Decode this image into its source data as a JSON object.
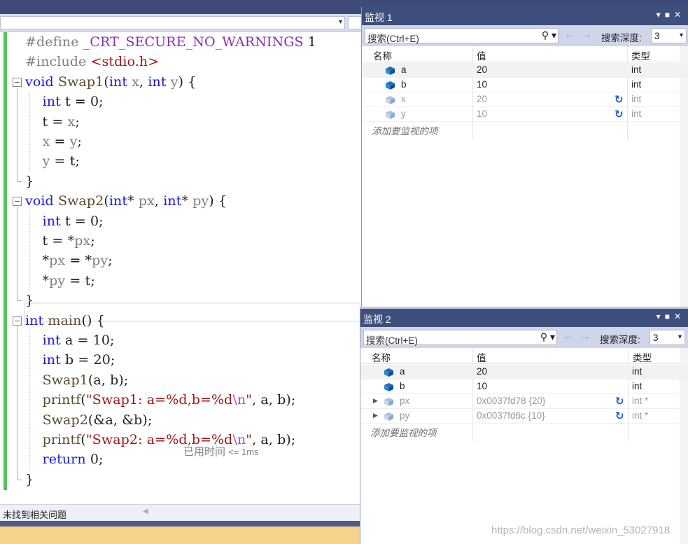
{
  "editor": {
    "lines": [
      {
        "parts": [
          {
            "c": "pp",
            "t": "#define "
          },
          {
            "c": "macro",
            "t": "_CRT_SECURE_NO_WARNINGS"
          },
          {
            "c": "",
            "t": " 1"
          }
        ]
      },
      {
        "parts": [
          {
            "c": "pp",
            "t": "#include "
          },
          {
            "c": "str",
            "t": "<stdio.h>"
          }
        ]
      },
      {
        "parts": [
          {
            "c": "kw",
            "t": "void"
          },
          {
            "c": "",
            "t": " "
          },
          {
            "c": "fn",
            "t": "Swap1"
          },
          {
            "c": "",
            "t": "("
          },
          {
            "c": "kw",
            "t": "int"
          },
          {
            "c": "pa",
            "t": " x"
          },
          {
            "c": "",
            "t": ", "
          },
          {
            "c": "kw",
            "t": "int"
          },
          {
            "c": "pa",
            "t": " y"
          },
          {
            "c": "",
            "t": ") {"
          }
        ]
      },
      {
        "parts": [
          {
            "c": "",
            "t": "    "
          },
          {
            "c": "kw",
            "t": "int"
          },
          {
            "c": "",
            "t": " t = 0;"
          }
        ]
      },
      {
        "parts": [
          {
            "c": "",
            "t": "    t = "
          },
          {
            "c": "pa",
            "t": "x"
          },
          {
            "c": "",
            "t": ";"
          }
        ]
      },
      {
        "parts": [
          {
            "c": "",
            "t": "    "
          },
          {
            "c": "pa",
            "t": "x"
          },
          {
            "c": "",
            "t": " = "
          },
          {
            "c": "pa",
            "t": "y"
          },
          {
            "c": "",
            "t": ";"
          }
        ]
      },
      {
        "parts": [
          {
            "c": "",
            "t": "    "
          },
          {
            "c": "pa",
            "t": "y"
          },
          {
            "c": "",
            "t": " = t;"
          }
        ]
      },
      {
        "parts": [
          {
            "c": "",
            "t": "}"
          }
        ]
      },
      {
        "parts": [
          {
            "c": "kw",
            "t": "void"
          },
          {
            "c": "",
            "t": " "
          },
          {
            "c": "fn",
            "t": "Swap2"
          },
          {
            "c": "",
            "t": "("
          },
          {
            "c": "kw",
            "t": "int"
          },
          {
            "c": "",
            "t": "* "
          },
          {
            "c": "pa",
            "t": "px"
          },
          {
            "c": "",
            "t": ", "
          },
          {
            "c": "kw",
            "t": "int"
          },
          {
            "c": "",
            "t": "* "
          },
          {
            "c": "pa",
            "t": "py"
          },
          {
            "c": "",
            "t": ") {"
          }
        ]
      },
      {
        "parts": [
          {
            "c": "",
            "t": "    "
          },
          {
            "c": "kw",
            "t": "int"
          },
          {
            "c": "",
            "t": " t = 0;"
          }
        ]
      },
      {
        "parts": [
          {
            "c": "",
            "t": "    t = *"
          },
          {
            "c": "pa",
            "t": "px"
          },
          {
            "c": "",
            "t": ";"
          }
        ]
      },
      {
        "parts": [
          {
            "c": "",
            "t": "    *"
          },
          {
            "c": "pa",
            "t": "px"
          },
          {
            "c": "",
            "t": " = *"
          },
          {
            "c": "pa",
            "t": "py"
          },
          {
            "c": "",
            "t": ";"
          }
        ]
      },
      {
        "parts": [
          {
            "c": "",
            "t": "    *"
          },
          {
            "c": "pa",
            "t": "py"
          },
          {
            "c": "",
            "t": " = t;"
          }
        ]
      },
      {
        "parts": [
          {
            "c": "",
            "t": "}"
          }
        ]
      },
      {
        "parts": [
          {
            "c": "kw",
            "t": "int"
          },
          {
            "c": "",
            "t": " "
          },
          {
            "c": "fn",
            "t": "main"
          },
          {
            "c": "",
            "t": "() {"
          }
        ]
      },
      {
        "parts": [
          {
            "c": "",
            "t": "    "
          },
          {
            "c": "kw",
            "t": "int"
          },
          {
            "c": "",
            "t": " a = 10;"
          }
        ]
      },
      {
        "parts": [
          {
            "c": "",
            "t": "    "
          },
          {
            "c": "kw",
            "t": "int"
          },
          {
            "c": "",
            "t": " b = 20;"
          }
        ]
      },
      {
        "parts": [
          {
            "c": "",
            "t": "    "
          },
          {
            "c": "fn",
            "t": "Swap1"
          },
          {
            "c": "",
            "t": "(a, b);"
          }
        ]
      },
      {
        "parts": [
          {
            "c": "",
            "t": "    "
          },
          {
            "c": "fn",
            "t": "printf"
          },
          {
            "c": "",
            "t": "("
          },
          {
            "c": "str",
            "t": "\"Swap1: a=%d,b=%d"
          },
          {
            "c": "esc",
            "t": "\\n"
          },
          {
            "c": "str",
            "t": "\""
          },
          {
            "c": "",
            "t": ", a, b);"
          }
        ]
      },
      {
        "parts": [
          {
            "c": "",
            "t": "    "
          },
          {
            "c": "fn",
            "t": "Swap2"
          },
          {
            "c": "",
            "t": "(&a, &b);"
          }
        ]
      },
      {
        "parts": [
          {
            "c": "",
            "t": "    "
          },
          {
            "c": "fn",
            "t": "printf"
          },
          {
            "c": "",
            "t": "("
          },
          {
            "c": "str",
            "t": "\"Swap2: a=%d,b=%d"
          },
          {
            "c": "esc",
            "t": "\\n"
          },
          {
            "c": "str",
            "t": "\""
          },
          {
            "c": "",
            "t": ", a, b);"
          }
        ]
      },
      {
        "parts": [
          {
            "c": "",
            "t": "    "
          },
          {
            "c": "kw",
            "t": "return"
          },
          {
            "c": "",
            "t": " 0;"
          }
        ]
      },
      {
        "parts": [
          {
            "c": "",
            "t": "}"
          }
        ]
      }
    ],
    "perf_tip": "已用时间",
    "perf_value": "<= 1ms",
    "status_text": "未找到相关问题"
  },
  "watch1": {
    "title": "监视 1",
    "search_placeholder": "搜索(Ctrl+E)",
    "depth_label": "搜索深度:",
    "depth_value": "3",
    "col_name": "名称",
    "col_value": "值",
    "col_type": "类型",
    "rows": [
      {
        "name": "a",
        "value": "20",
        "type": "int",
        "stale": false,
        "refresh": false
      },
      {
        "name": "b",
        "value": "10",
        "type": "int",
        "stale": false,
        "refresh": false
      },
      {
        "name": "x",
        "value": "20",
        "type": "int",
        "stale": true,
        "refresh": true
      },
      {
        "name": "y",
        "value": "10",
        "type": "int",
        "stale": true,
        "refresh": true
      }
    ],
    "add_item": "添加要监视的项"
  },
  "watch2": {
    "title": "监视 2",
    "search_placeholder": "搜索(Ctrl+E)",
    "depth_label": "搜索深度:",
    "depth_value": "3",
    "col_name": "名称",
    "col_value": "值",
    "col_type": "类型",
    "rows": [
      {
        "name": "a",
        "value": "20",
        "type": "int",
        "stale": false,
        "refresh": false,
        "expandable": false
      },
      {
        "name": "b",
        "value": "10",
        "type": "int",
        "stale": false,
        "refresh": false,
        "expandable": false
      },
      {
        "name": "px",
        "value": "0x0037fd78 {20}",
        "type": "int *",
        "stale": true,
        "refresh": true,
        "expandable": true
      },
      {
        "name": "py",
        "value": "0x0037fd6c {10}",
        "type": "int *",
        "stale": true,
        "refresh": true,
        "expandable": true
      }
    ],
    "add_item": "添加要监视的项"
  },
  "watermark": "https://blog.csdn.net/weixin_53027918",
  "colors": {
    "keyword": "#1a1ad6",
    "string": "#a31515",
    "change_bar": "#57c25a",
    "titlebar": "#3f4f7d"
  }
}
